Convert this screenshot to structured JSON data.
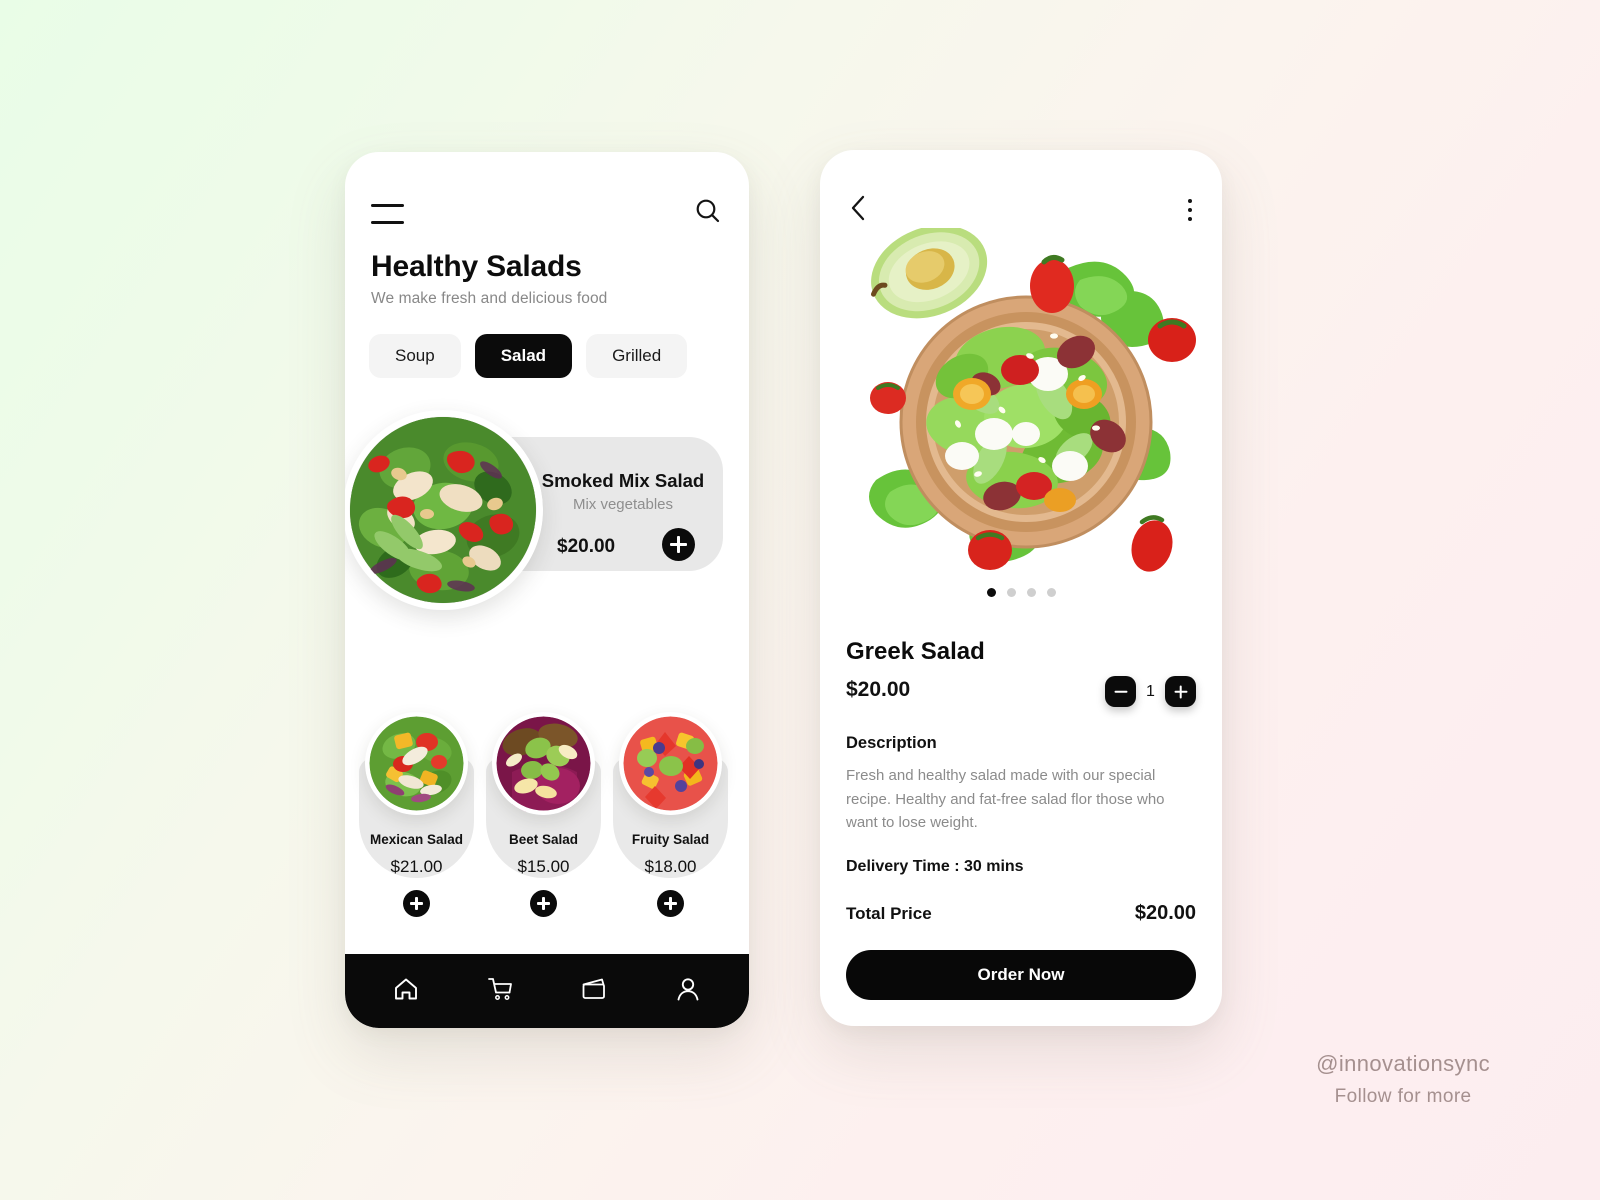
{
  "background": {
    "start_color": "#e9fde7",
    "end_color": "#fcedef"
  },
  "list_screen": {
    "menu_icon": "hamburger-icon",
    "search_icon": "search-icon",
    "title": "Healthy Salads",
    "subtitle": "We make fresh and delicious food",
    "categories": [
      {
        "label": "Soup",
        "active": false
      },
      {
        "label": "Salad",
        "active": true
      },
      {
        "label": "Grilled",
        "active": false
      }
    ],
    "featured": {
      "name": "Smoked Mix Salad",
      "description": "Mix vegetables",
      "price": "$20.00",
      "add_icon": "plus-icon",
      "image_alt": "smoked-mix-salad-bowl"
    },
    "products": [
      {
        "name": "Mexican Salad",
        "price": "$21.00",
        "add_icon": "plus-icon"
      },
      {
        "name": "Beet Salad",
        "price": "$15.00",
        "add_icon": "plus-icon"
      },
      {
        "name": "Fruity Salad",
        "price": "$18.00",
        "add_icon": "plus-icon"
      }
    ],
    "nav": [
      {
        "icon": "home-icon",
        "active": true
      },
      {
        "icon": "cart-icon",
        "active": false
      },
      {
        "icon": "wallet-icon",
        "active": false
      },
      {
        "icon": "profile-icon",
        "active": false
      }
    ]
  },
  "detail_screen": {
    "back_icon": "back-chevron-icon",
    "more_icon": "more-vertical-icon",
    "hero_image_alt": "greek-salad-bowl-with-vegetables",
    "carousel": {
      "count": 4,
      "active_index": 0
    },
    "title": "Greek Salad",
    "price": "$20.00",
    "quantity": "1",
    "decrease_icon": "minus-icon",
    "increase_icon": "plus-icon",
    "description_label": "Description",
    "description": "Fresh and healthy salad made with our special recipe. Healthy and fat-free salad flor those who want to lose weight.",
    "delivery": "Delivery Time : 30 mins",
    "total_label": "Total Price",
    "total_value": "$20.00",
    "order_button": "Order Now"
  },
  "watermark": {
    "handle": "@innovationsync",
    "tagline": "Follow for more"
  }
}
